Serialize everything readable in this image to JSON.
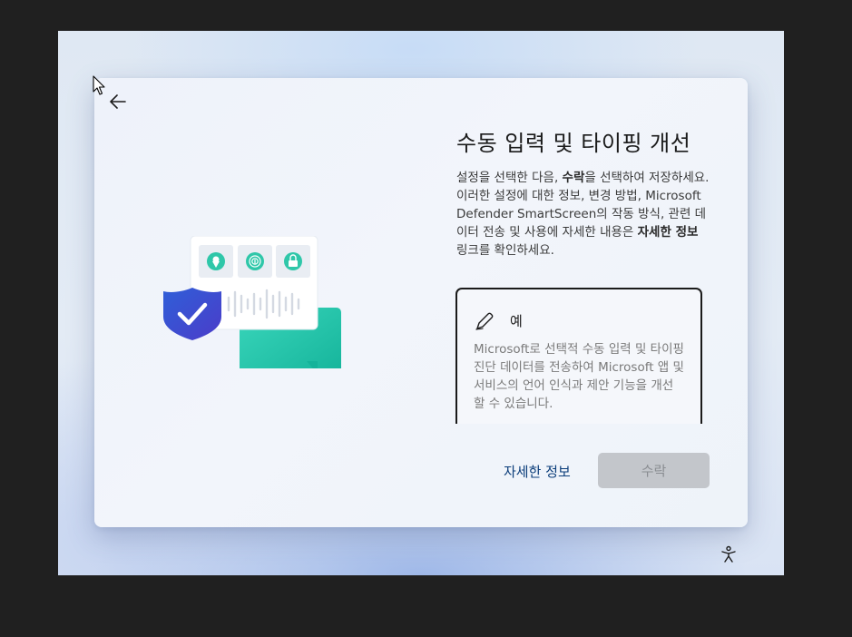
{
  "oobe": {
    "title": "수동 입력 및 타이핑 개선",
    "description": {
      "part1": "설정을 선택한 다음, ",
      "accept_word": "수락",
      "part2": "을 선택하여 저장하세요. 이러한 설정에 대한 정보, 변경 방법, Microsoft Defender SmartScreen의 작동 방식, 관련 데이터 전송 및 사용에 자세한 내용은 ",
      "learn_more_word": "자세한 정보",
      "part3": " 링크를 확인하세요."
    },
    "options": [
      {
        "label": "예",
        "icon": "pen-icon",
        "description": "Microsoft로 선택적 수동 입력 및 타이핑 진단 데이터를 전송하여 Microsoft 앱 및 서비스의 언어 인식과 제안 기능을 개선할 수 있습니다."
      }
    ],
    "learn_more_link": "자세한 정보",
    "accept_button": "수락"
  },
  "icons": {
    "back": "back-arrow-icon",
    "accessibility": "accessibility-icon",
    "shield": "shield-check-icon",
    "location": "location-pin-icon",
    "fingerprint": "fingerprint-icon",
    "lock": "lock-icon",
    "chat": "chat-bubble-icon",
    "waveform": "waveform-icon"
  },
  "colors": {
    "shield_blue": "#3b5bdb",
    "teal": "#2fc7a9",
    "accept_disabled_bg": "#c3c6cb",
    "link": "#0b3d7a"
  }
}
